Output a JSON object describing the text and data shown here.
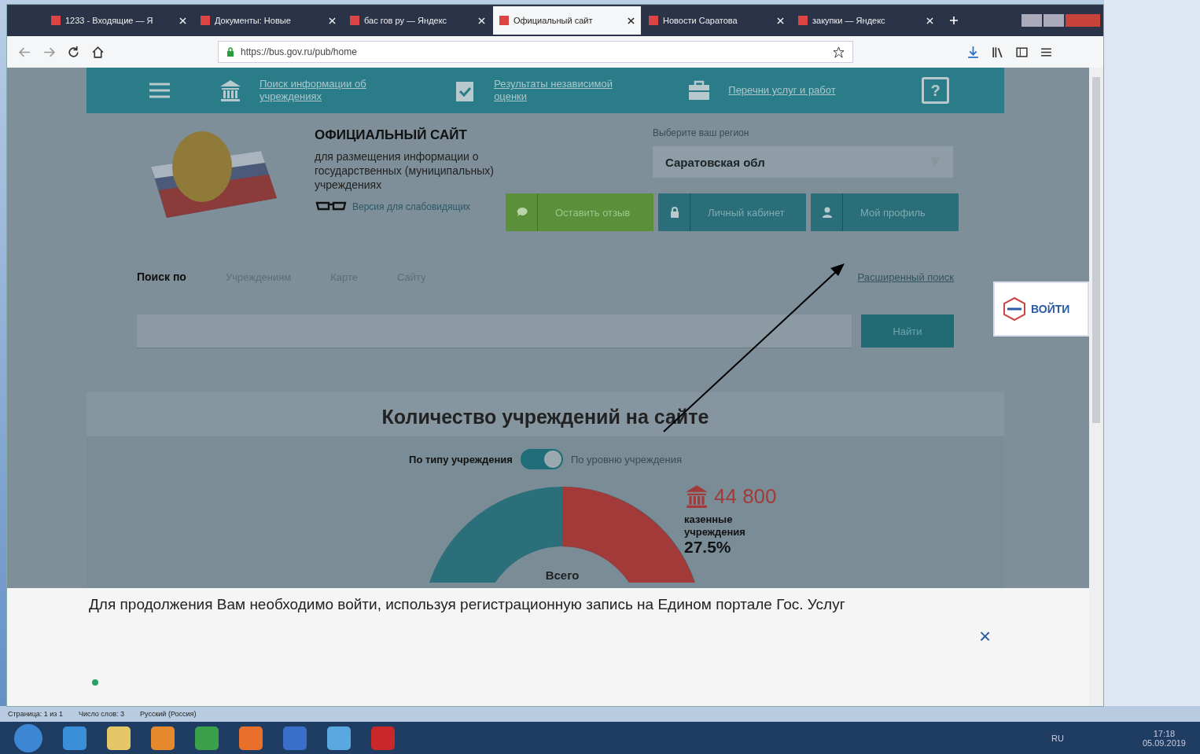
{
  "browser": {
    "tabs": [
      {
        "title": "1233 - Входящие — Я",
        "selected": false
      },
      {
        "title": "Документы: Новые",
        "selected": false
      },
      {
        "title": "бас гов ру — Яндекс",
        "selected": false
      },
      {
        "title": "Официальный сайт",
        "selected": true
      },
      {
        "title": "Новости Саратова",
        "selected": false
      },
      {
        "title": "закупки — Яндекс",
        "selected": false
      }
    ],
    "url": "https://bus.gov.ru/pub/home"
  },
  "site": {
    "nav": [
      "Поиск информации об учреждениях",
      "Результаты независимой оценки",
      "Перечни услуг и работ"
    ],
    "header": {
      "title": "ОФИЦИАЛЬНЫЙ САЙТ",
      "subtitle": "для размещения информации о государственных (муниципальных) учреждениях",
      "low_vision": "Версия для слабовидящих",
      "region_label": "Выберите ваш регион",
      "region": "Саратовская обл",
      "buttons": [
        {
          "label": "Оставить отзыв",
          "kind": "feedback"
        },
        {
          "label": "Личный кабинет",
          "kind": "cabinet"
        },
        {
          "label": "Мой профиль",
          "kind": "profile"
        }
      ]
    },
    "search": {
      "label": "Поиск по",
      "options": [
        "Учреждениям",
        "Карте",
        "Сайту"
      ],
      "advanced": "Расширенный поиск",
      "button": "Найти"
    },
    "stats": {
      "title": "Количество учреждений на сайте",
      "toggle": {
        "left": "По типу учреждения",
        "right": "По уровню учреждения",
        "on": true
      },
      "highlight": {
        "value": "44 800",
        "label": "казенные учреждения",
        "percent": "27.5%"
      },
      "center_label": "Всего"
    },
    "help_glyph": "?",
    "login_button": "ВОЙТИ",
    "banner": {
      "message": "Для продолжения Вам необходимо войти, используя регистрационную запись на Едином портале Гос. Услуг",
      "close": "×"
    }
  },
  "word_status": [
    "Страница: 1 из 1",
    "Число слов: 3",
    "Русский (Россия)"
  ],
  "taskbar": {
    "language": "RU",
    "time": "17:18",
    "date": "05.09.2019"
  }
}
